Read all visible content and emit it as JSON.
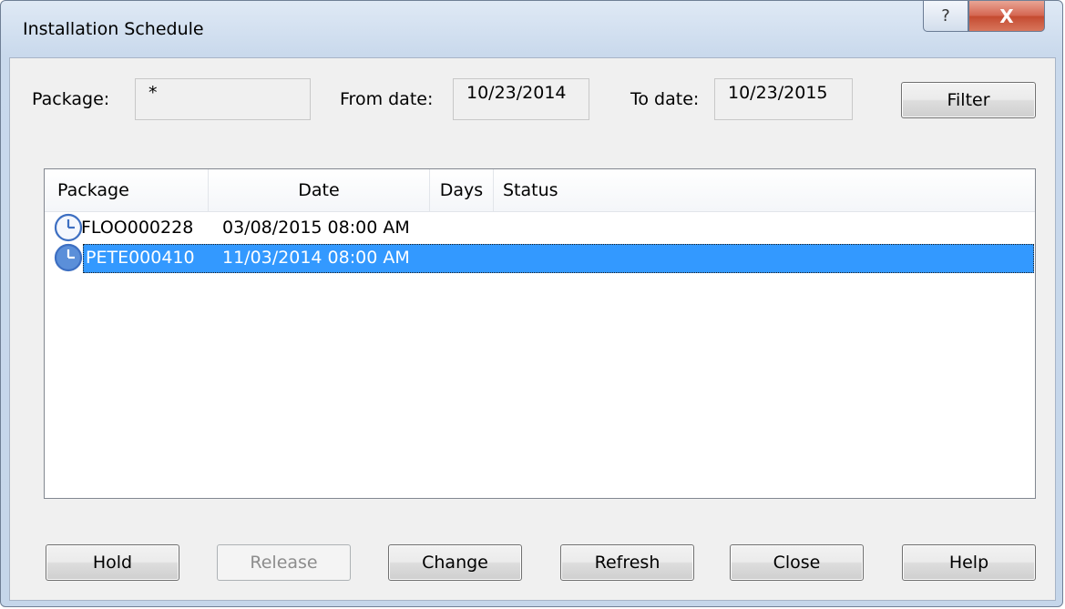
{
  "window": {
    "title": "Installation Schedule",
    "help_glyph": "?",
    "close_glyph": "X"
  },
  "filter": {
    "package_label": "Package:",
    "package_value": "*",
    "from_label": "From date:",
    "from_value": "10/23/2014",
    "to_label": "To date:",
    "to_value": "10/23/2015",
    "filter_button": "Filter"
  },
  "list": {
    "columns": [
      "Package",
      "Date",
      "Days",
      "Status"
    ],
    "rows": [
      {
        "icon": "clock-icon",
        "package": "FLOO000228",
        "date": "03/08/2015  08:00 AM",
        "days": "",
        "status": "",
        "selected": false
      },
      {
        "icon": "clock-icon",
        "package": "PETE000410",
        "date": "11/03/2014  08:00 AM",
        "days": "",
        "status": "",
        "selected": true
      }
    ]
  },
  "buttons": {
    "hold": "Hold",
    "release": "Release",
    "change": "Change",
    "refresh": "Refresh",
    "close": "Close",
    "help": "Help"
  },
  "colors": {
    "selection": "#3399ff",
    "clock_face": "#5b8fd9"
  }
}
